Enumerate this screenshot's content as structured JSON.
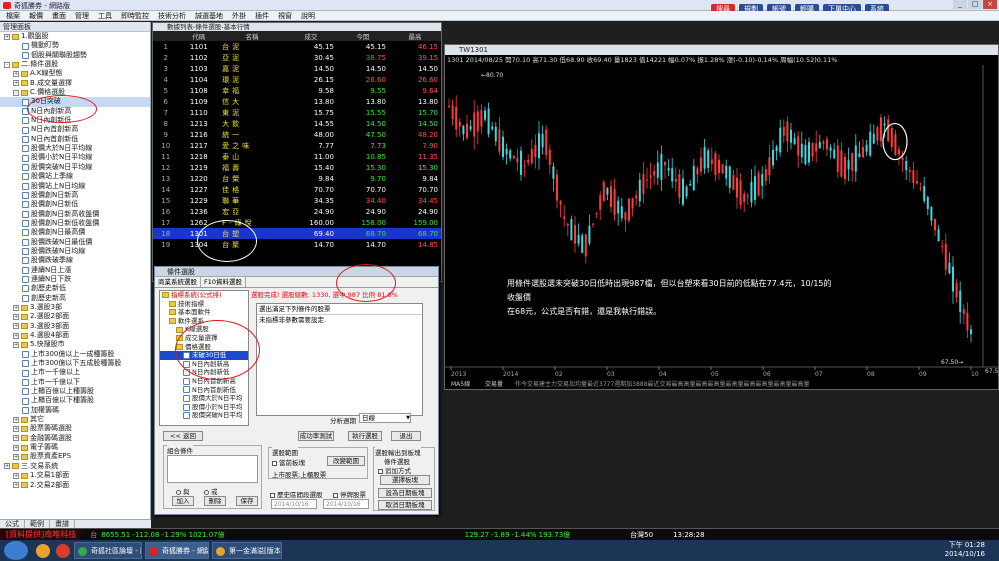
{
  "window": {
    "title": "奇狐勝券 - 網路版"
  },
  "menu": [
    "檔案",
    "報價",
    "畫面",
    "管理",
    "工具",
    "即時監控",
    "技術分析",
    "誠選基地",
    "外掛",
    "插件",
    "視窗",
    "說明"
  ],
  "toolbar": [
    "搜尋",
    "規劃",
    "帳號",
    "輕購",
    "下單中心",
    "系統"
  ],
  "left_panel": {
    "header": "管理面板",
    "tabs": [
      "公式",
      "範例",
      "畫譜"
    ],
    "items": [
      "1.觀盤股",
      "機動盯勢",
      "個股與關聯股趨勢",
      "二.條件選股",
      "A.K線型態",
      "B.成交量選擇",
      "C.價格選股",
      "30日突破",
      "N日內創新高",
      "N日內創新低",
      "N日內首創新高",
      "N日內首創新低",
      "股價大於N日平均線",
      "股價小於N日平均線",
      "股價突破N日平均線",
      "股價站上季線",
      "股價站上N日均線",
      "股價創N日新高",
      "股價創N日新低",
      "股價創N日新高收盤價",
      "股價創N日新低收盤價",
      "股價創N日最高價",
      "股價跌破N日最低價",
      "股價跌破N日均線",
      "股價跌破季線",
      "連續N日上漲",
      "連續N日下跌",
      "創歷史新低",
      "創歷史新高",
      "3.選股3部",
      "2.選股2部面",
      "3.選股3部面",
      "4.選股4部面",
      "5.快搜股市",
      "上市300億以上一成種籌股",
      "上市300億以下五成股種籌股",
      "上市一千億以上",
      "上市一千億以下",
      "上櫃百億以上種籌股",
      "上櫃百億以下種籌股",
      "加權籌碼",
      "其它",
      "股票籌碼選股",
      "金融籌碼選股",
      "電子籌碼",
      "股票資產EPS",
      "三.交易系統",
      "1.交易1部面",
      "2.交易2部面"
    ]
  },
  "quote_list": {
    "title": "數據列表-條件選股-基本行情",
    "columns": [
      "",
      "代碼",
      "名稱",
      "成交",
      "今開",
      "最高"
    ],
    "rows": [
      [
        "1",
        "1101",
        "台泥",
        "45.15",
        "45.15",
        "46.15"
      ],
      [
        "2",
        "1102",
        "亞泥",
        "30.45",
        "38.75",
        "39.15"
      ],
      [
        "3",
        "1103",
        "嘉泥",
        "14.50",
        "14.50",
        "14.50"
      ],
      [
        "4",
        "1104",
        "環泥",
        "26.15",
        "26.60",
        "26.60"
      ],
      [
        "5",
        "1108",
        "幸福",
        "9.58",
        "9.55",
        "9.64"
      ],
      [
        "6",
        "1109",
        "信大",
        "13.80",
        "13.80",
        "13.80"
      ],
      [
        "7",
        "1110",
        "東泥",
        "15.75",
        "15.55",
        "15.70"
      ],
      [
        "8",
        "1213",
        "大飲",
        "14.55",
        "14.50",
        "14.50"
      ],
      [
        "9",
        "1216",
        "統一",
        "48.00",
        "47.50",
        "48.20"
      ],
      [
        "10",
        "1217",
        "愛之味",
        "7.77",
        "7.73",
        "7.90"
      ],
      [
        "11",
        "1218",
        "泰山",
        "11.00",
        "10.85",
        "11.35"
      ],
      [
        "12",
        "1219",
        "福壽",
        "15.40",
        "15.30",
        "15.30"
      ],
      [
        "13",
        "1220",
        "台榮",
        "9.84",
        "9.70",
        "9.84"
      ],
      [
        "14",
        "1227",
        "佳格",
        "70.70",
        "70.70",
        "70.70"
      ],
      [
        "15",
        "1229",
        "聯華",
        "34.35",
        "34.40",
        "34.45"
      ],
      [
        "16",
        "1236",
        "宏亞",
        "24.90",
        "24.90",
        "24.90"
      ],
      [
        "17",
        "1262",
        "F-綠悅",
        "160.00",
        "158.00",
        "159.00"
      ],
      [
        "18",
        "1301",
        "台塑",
        "69.40",
        "68.70",
        "68.70"
      ],
      [
        "19",
        "1304",
        "台聚",
        "14.70",
        "14.70",
        "14.85"
      ]
    ]
  },
  "chart_window": {
    "title": "TW1301",
    "info": "1301 2014/08/25 開70.10 高71.30 低68.90 收69.40 量1823 值14221 幅0.07% 振1.28% 漲(-0.10)-0.14% 周幅(10.52)0.11%",
    "annotation_1": "用條件選股選未突破30日低時出現987檔，但以台塑來看30日前的低點在77.4元，10/15的收盤價",
    "annotation_2": "在68元，公式是否有錯，還是我執行錯誤。",
    "tick_labels": [
      "2013",
      "2014",
      "02",
      "03",
      "04",
      "05",
      "06",
      "07",
      "08",
      "09",
      "10"
    ],
    "price_labels": [
      "80.70",
      "67.50"
    ],
    "bottom_strip": [
      "MA5線",
      "交易量",
      "作今交易建主力交易加均量最近3777週期加3888最近交易最高高量最高最高量最高量最高最高量最高量最高量"
    ]
  },
  "chart_data": {
    "type": "line",
    "title": "",
    "x": [
      "2013",
      "2014",
      "02",
      "03",
      "04",
      "05",
      "06",
      "07",
      "08",
      "09",
      "10"
    ],
    "ylim": [
      67.5,
      80.7
    ]
  },
  "dialog": {
    "title": "條件選股",
    "tabs": [
      "商業系統選股",
      "F10資料選股"
    ],
    "tree": [
      "指標系統(公式排)",
      "技術指標",
      "基本面軟件",
      "軟件選系",
      "K線選股",
      "成交量選擇",
      "價格選股",
      "未破30日低",
      "N日內創新高",
      "N日內創新低",
      "N日內首創新高",
      "N日內首創新低",
      "股價大於N日平均",
      "股價小於N日平均",
      "股價突破N日平均"
    ],
    "status": "選股完成! 選股總數: 1330, 選中 987 比例 81.8%",
    "panel_a": "選出滿足下列條件的股票",
    "panel_b": "未指標非參數需要設定.",
    "analysis_label": "分析週期",
    "analysis_value": "日線",
    "back": "<< 返回",
    "group_combine": "組合條件",
    "radio_and": "與",
    "radio_or": "或",
    "btn_add": "加入",
    "btn_del": "刪除",
    "btn_save": "保存",
    "btn_rate": "成功率測試",
    "btn_run": "執行選股",
    "btn_exit": "退出",
    "range_label": "選股範圍",
    "range_chk": "當前板塊",
    "range_btn": "改變範圍",
    "range_text": "上市股票;上櫃股票",
    "output_label": "選股輸出到板塊",
    "cond_label": "條件選股",
    "add_method": "追加方式",
    "btn_select_block": "選擇板塊",
    "hist_label": "歷史區間段選股",
    "stop_label": "停牌股票",
    "date_from": "2014/10/16",
    "date_to": "2014/10/16",
    "btn_day": "設為日期板塊",
    "btn_cancel_day": "取消日期板塊"
  },
  "status_bar": {
    "left": "[資料提供]奇唯科技",
    "idx1_name": "台",
    "idx1": "8655.51 -112.08 -1.29% 1021.07億",
    "idx2": "129.27 -1.89 -1.44% 193.73億",
    "time": "13:28:28",
    "market": "台灣50"
  },
  "taskbar": {
    "items": [
      "奇狐社區論壇 - [...",
      "奇狐勝券 - 網路版",
      "第一金滿溢[版本..."
    ],
    "time": "下午 01:28",
    "date": "2014/10/16"
  },
  "colors": {
    "up": "#ff3b3b",
    "down": "#39d9e0",
    "circle": "#e3151a",
    "highlight": "#1a35c8"
  }
}
